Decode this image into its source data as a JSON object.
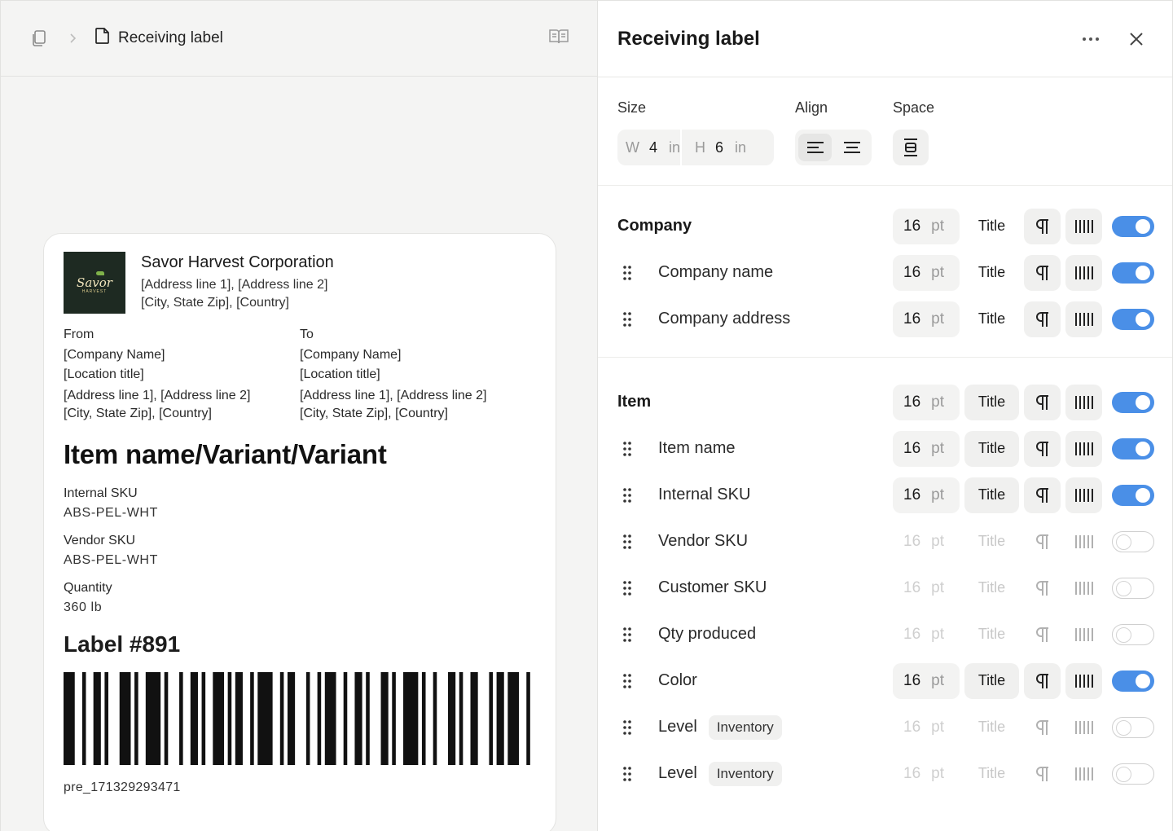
{
  "breadcrumb": {
    "current": "Receiving label"
  },
  "label": {
    "logo_text": "Savor",
    "logo_subtext": "HARVEST",
    "company_name": "Savor Harvest Corporation",
    "company_address_1": "[Address line 1], [Address line 2]",
    "company_address_2": "[City, State Zip], [Country]",
    "from": {
      "heading": "From",
      "company": "[Company Name]",
      "location": "[Location title]",
      "address_1": "[Address line 1], [Address line 2]",
      "address_2": "[City, State Zip], [Country]"
    },
    "to": {
      "heading": "To",
      "company": "[Company Name]",
      "location": "[Location title]",
      "address_1": "[Address line 1], [Address line 2]",
      "address_2": "[City, State Zip], [Country]"
    },
    "item_title": "Item name/Variant/Variant",
    "fields": [
      {
        "key": "Internal SKU",
        "value": "ABS-PEL-WHT"
      },
      {
        "key": "Vendor SKU",
        "value": "ABS-PEL-WHT"
      },
      {
        "key": "Quantity",
        "value": "360 lb"
      }
    ],
    "label_number": "Label #891",
    "barcode_value": "pre_171329293471"
  },
  "panel": {
    "title": "Receiving label",
    "size": {
      "label": "Size",
      "w_prefix": "W",
      "w_value": "4",
      "w_unit": "in",
      "h_prefix": "H",
      "h_value": "6",
      "h_unit": "in"
    },
    "align_label": "Align",
    "space_label": "Space",
    "company_section": {
      "title": "Company",
      "pt": "16",
      "unit": "pt",
      "style": "Title",
      "rows": [
        {
          "name": "Company name",
          "pt": "16",
          "unit": "pt",
          "style": "Title"
        },
        {
          "name": "Company address",
          "pt": "16",
          "unit": "pt",
          "style": "Title"
        }
      ]
    },
    "item_section": {
      "title": "Item",
      "pt": "16",
      "unit": "pt",
      "style": "Title",
      "rows": [
        {
          "name": "Item name",
          "pt": "16",
          "unit": "pt",
          "style": "Title"
        },
        {
          "name": "Internal SKU",
          "pt": "16",
          "unit": "pt",
          "style": "Title"
        },
        {
          "name": "Vendor SKU",
          "pt": "16",
          "unit": "pt",
          "style": "Title"
        },
        {
          "name": "Customer SKU",
          "pt": "16",
          "unit": "pt",
          "style": "Title"
        },
        {
          "name": "Qty produced",
          "pt": "16",
          "unit": "pt",
          "style": "Title"
        },
        {
          "name": "Color",
          "pt": "16",
          "unit": "pt",
          "style": "Title"
        },
        {
          "name": "Level",
          "tag": "Inventory",
          "pt": "16",
          "unit": "pt",
          "style": "Title"
        },
        {
          "name": "Level",
          "tag": "Inventory",
          "pt": "16",
          "unit": "pt",
          "style": "Title"
        }
      ]
    }
  },
  "colors": {
    "toggle_on": "#4a8fe7",
    "logo_bg": "#1e2a22"
  }
}
